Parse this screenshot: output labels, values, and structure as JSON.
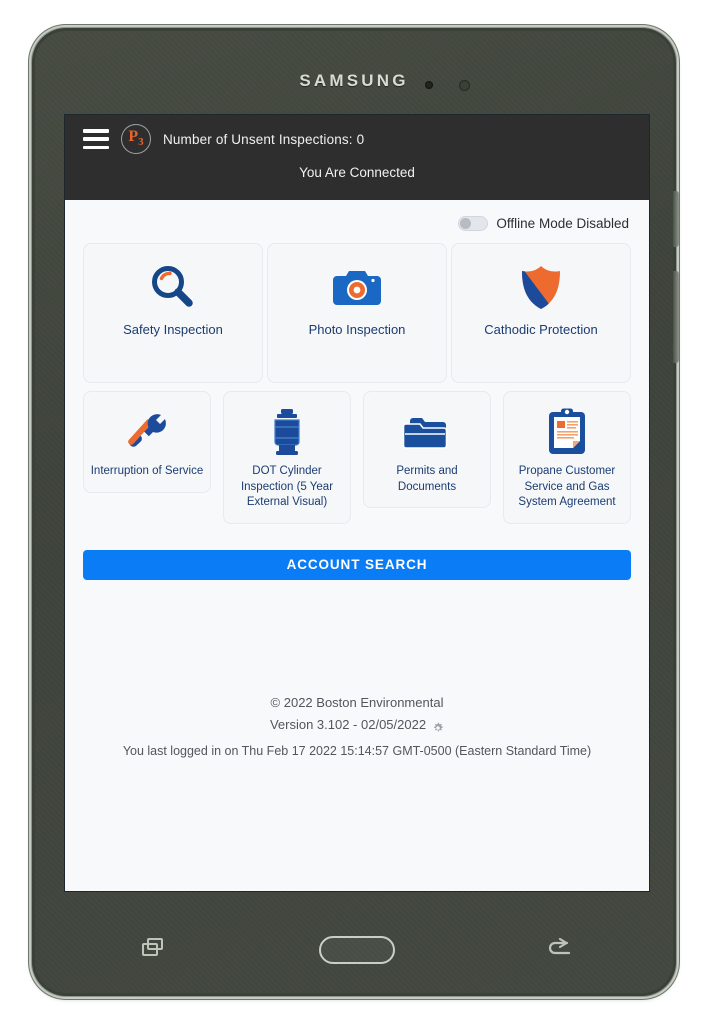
{
  "device": {
    "brand": "SAMSUNG",
    "nav": {
      "recents_label": "Recents",
      "home_label": "Home",
      "back_label": "Back"
    }
  },
  "header": {
    "menu_icon": "hamburger-icon",
    "logo_text": "P",
    "logo_subscript": "3",
    "unsent_inspections": "Number of Unsent Inspections: 0",
    "connection_status": "You Are Connected",
    "background_color": "#2e2e2e"
  },
  "offline": {
    "label": "Offline Mode Disabled",
    "enabled": false
  },
  "tiles_row_1": [
    {
      "label": "Safety Inspection",
      "icon": "magnifier-icon"
    },
    {
      "label": "Photo Inspection",
      "icon": "camera-icon"
    },
    {
      "label": "Cathodic Protection",
      "icon": "shield-icon"
    }
  ],
  "tiles_row_2": [
    {
      "label": "Interruption of Service",
      "icon": "tools-icon"
    },
    {
      "label": "DOT Cylinder Inspection (5 Year External Visual)",
      "icon": "propane-tank-icon"
    },
    {
      "label": "Permits and Documents",
      "icon": "folder-icon"
    },
    {
      "label": "Propane Customer Service and Gas System Agreement",
      "icon": "clipboard-icon"
    }
  ],
  "account_search": {
    "label": "ACCOUNT SEARCH",
    "color": "#0a7cf6"
  },
  "footer": {
    "copyright": "© 2022 Boston Environmental",
    "version": "Version 3.102 - 02/05/2022",
    "gear_icon": "gear-icon",
    "last_login": "You last logged in on Thu Feb 17 2022 15:14:57 GMT-0500 (Eastern Standard Time)"
  },
  "colors": {
    "brand_orange": "#e8642a",
    "brand_blue": "#1b4b9c",
    "accent_blue": "#0a7cf6",
    "label_blue": "#1b3c73"
  }
}
